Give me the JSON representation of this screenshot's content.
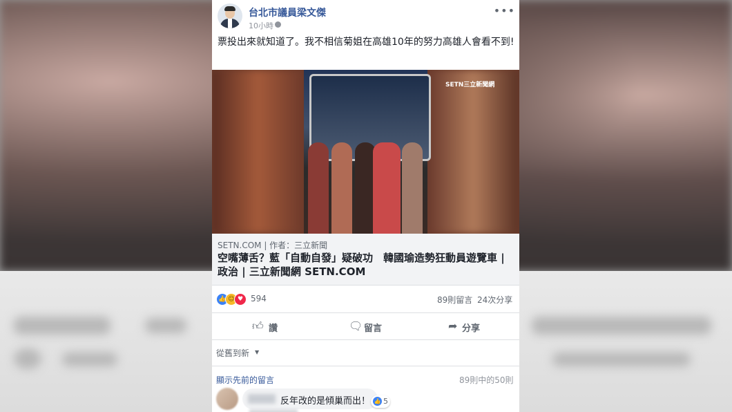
{
  "post": {
    "author": "台北市議員梁文傑",
    "time": "10小時",
    "menu_icon": "•••",
    "text": "票投出來就知道了。我不相信菊姐在高雄10年的努力高雄人會看不到!"
  },
  "media": {
    "watermark": "SETN三立新聞網"
  },
  "link_preview": {
    "source": "SETN.COM | 作者：三立新聞",
    "title": "空嘴薄舌？藍「自動自發」疑破功　韓國瑜造勢狂動員遊覽車 | 政治 | 三立新聞網 SETN.COM"
  },
  "stats": {
    "reactions": [
      "like",
      "haha",
      "love"
    ],
    "reaction_count": "594",
    "comments": "89則留言",
    "shares": "24次分享"
  },
  "actions": {
    "like": {
      "label": "讚",
      "icon": "thumbs-up-icon"
    },
    "comment": {
      "label": "留言",
      "icon": "comment-icon"
    },
    "share": {
      "label": "分享",
      "icon": "share-icon"
    }
  },
  "comments_section": {
    "sort_label": "從舊到新",
    "view_previous": "顯示先前的留言",
    "count_label": "89則中的50則",
    "comment": {
      "text": "反年改的是傾巢而出！",
      "likes": "5"
    }
  },
  "colors": {
    "link_blue": "#365899",
    "reaction_like": "#3b82f6",
    "reaction_haha": "#f7b928",
    "reaction_love": "#f0284a"
  }
}
